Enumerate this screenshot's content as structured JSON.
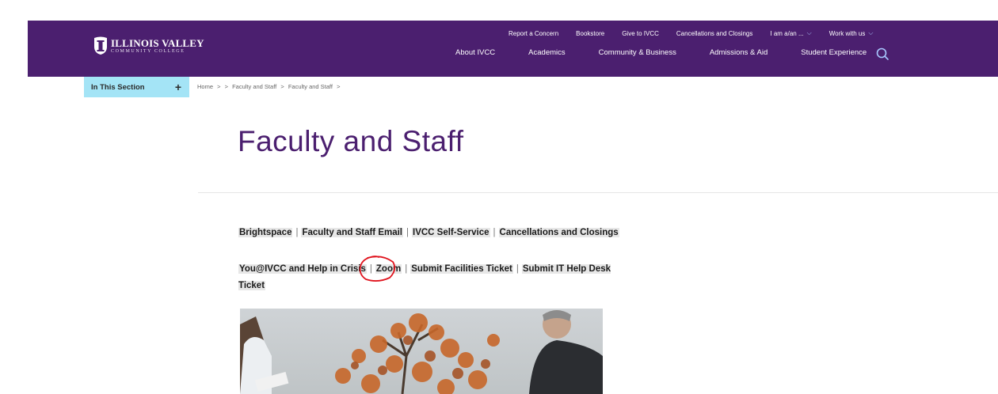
{
  "header": {
    "logo_line1": "ILLINOIS VALLEY",
    "logo_line2": "COMMUNITY COLLEGE",
    "utility_links": [
      "Report a Concern",
      "Bookstore",
      "Give to IVCC",
      "Cancellations and Closings"
    ],
    "utility_dropdowns": [
      "I am a/an ...",
      "Work with us"
    ],
    "main_nav": [
      "About IVCC",
      "Academics",
      "Community & Business",
      "Admissions & Aid",
      "Student Experience"
    ]
  },
  "sidebar": {
    "section_label": "In This Section",
    "toggle": "+"
  },
  "breadcrumb": {
    "items": [
      "Home",
      "Faculty and Staff",
      "Faculty and Staff"
    ],
    "separator": ">"
  },
  "page_title": "Faculty and Staff",
  "quick_links_row1": [
    "Brightspace",
    "Faculty and Staff Email",
    "IVCC Self-Service",
    "Cancellations and Closings"
  ],
  "quick_links_row2": [
    "You@IVCC and Help in Crisis",
    "Zoom",
    "Submit Facilities Ticket",
    "Submit IT Help Desk Ticket"
  ],
  "link_separator": "|",
  "colors": {
    "brand_purple": "#4b1f6f",
    "section_cyan": "#a4e4f6",
    "annotation_red": "#e0141e"
  }
}
